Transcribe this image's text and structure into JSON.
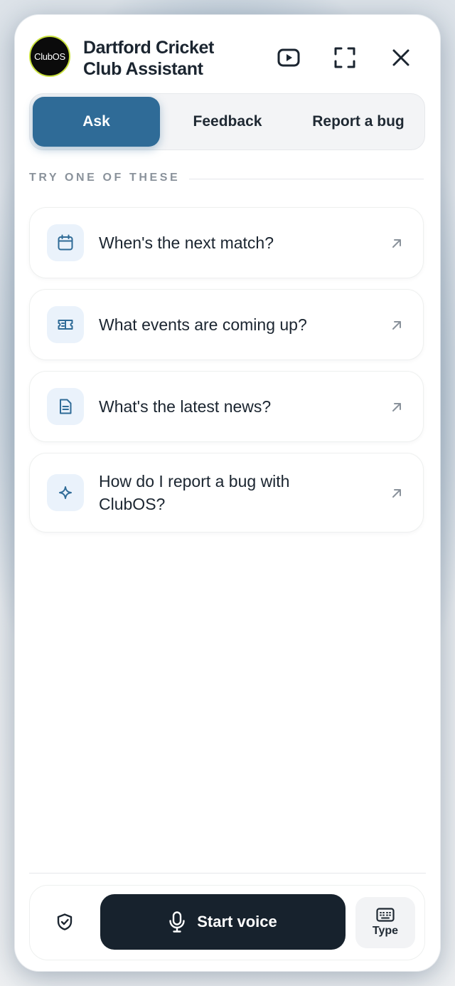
{
  "header": {
    "logo_text": "ClubOS",
    "title": "Dartford Cricket Club Assistant",
    "icons": [
      "play-video-icon",
      "fullscreen-icon",
      "close-icon"
    ]
  },
  "tabs": [
    {
      "label": "Ask",
      "active": true
    },
    {
      "label": "Feedback",
      "active": false
    },
    {
      "label": "Report a bug",
      "active": false
    }
  ],
  "suggestions": {
    "heading": "TRY ONE OF THESE",
    "items": [
      {
        "text": "When's the next match?",
        "icon": "calendar-icon"
      },
      {
        "text": "What events are coming up?",
        "icon": "ticket-icon"
      },
      {
        "text": "What's the latest news?",
        "icon": "document-icon"
      },
      {
        "text": "How do I report a bug with ClubOS?",
        "icon": "sparkle-icon"
      }
    ]
  },
  "footer": {
    "start_voice_label": "Start voice",
    "type_label": "Type",
    "icons": [
      "shield-check-icon",
      "microphone-icon",
      "keyboard-icon"
    ]
  },
  "colors": {
    "accent": "#2f6b97",
    "dark_button": "#17222d",
    "icon_tile": "#eaf2fb",
    "logo_ring": "#c8e03c"
  }
}
